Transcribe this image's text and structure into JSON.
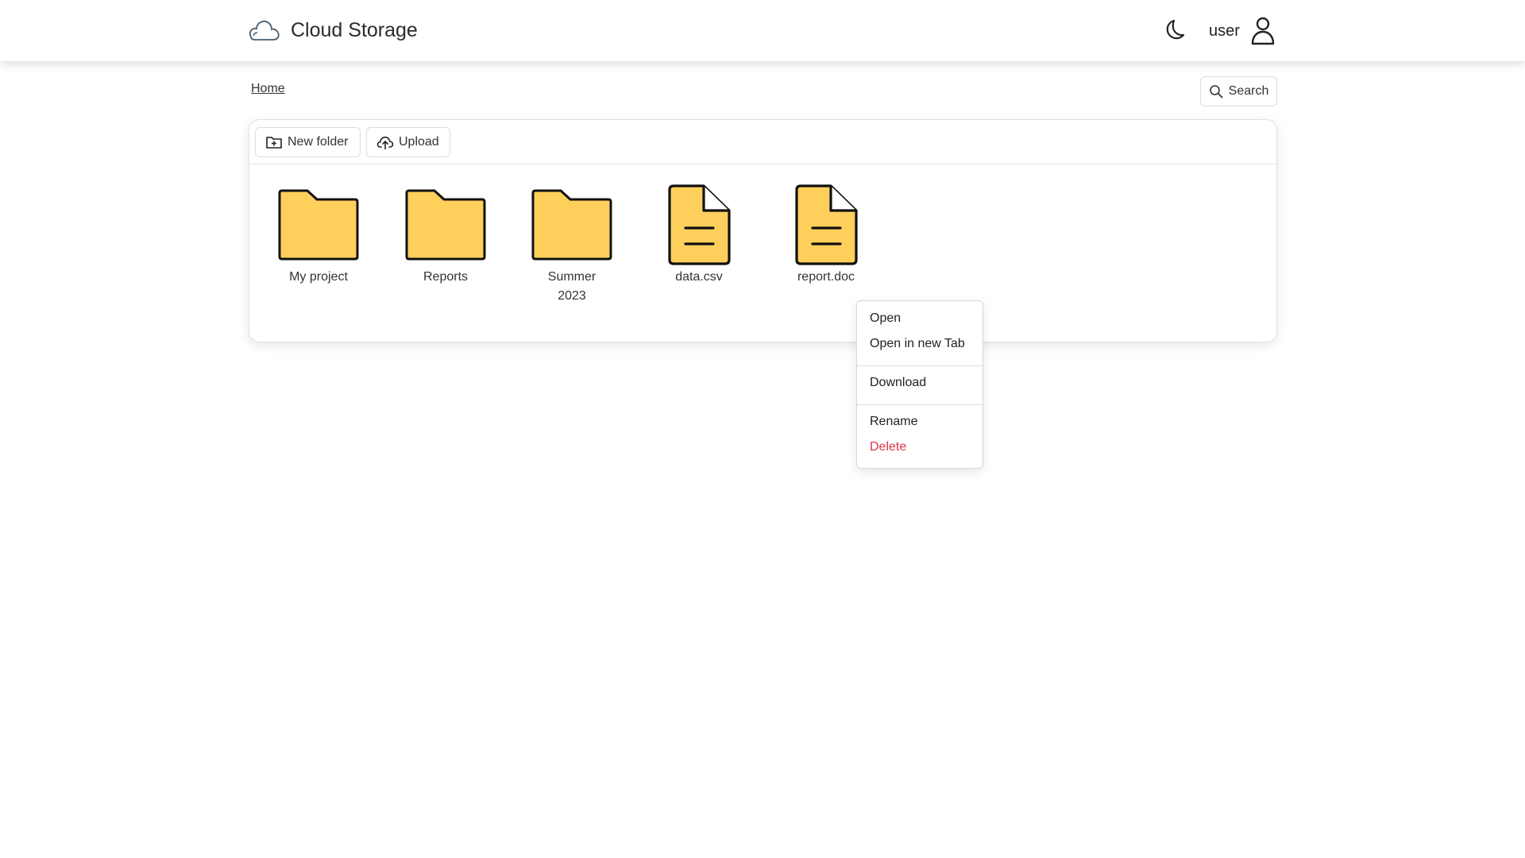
{
  "app": {
    "title": "Cloud Storage",
    "logo_icon": "cloud-icon"
  },
  "header": {
    "theme_icon": "moon-icon",
    "username": "user",
    "user_icon": "user-icon"
  },
  "breadcrumb": {
    "home": "Home"
  },
  "search": {
    "label": "Search",
    "icon": "search-icon"
  },
  "toolbar": {
    "new_folder_label": "New folder",
    "new_folder_icon": "folder-plus-icon",
    "upload_label": "Upload",
    "upload_icon": "cloud-upload-icon"
  },
  "items": [
    {
      "name": "My project",
      "type": "folder"
    },
    {
      "name": "Reports",
      "type": "folder"
    },
    {
      "name": "Summer 2023",
      "type": "folder"
    },
    {
      "name": "data.csv",
      "type": "file"
    },
    {
      "name": "report.doc",
      "type": "file"
    }
  ],
  "context_menu": {
    "open": "Open",
    "open_new_tab": "Open in new Tab",
    "download": "Download",
    "rename": "Rename",
    "delete": "Delete"
  },
  "colors": {
    "item_fill": "#FFCF5C",
    "delete": "#dc3545"
  }
}
